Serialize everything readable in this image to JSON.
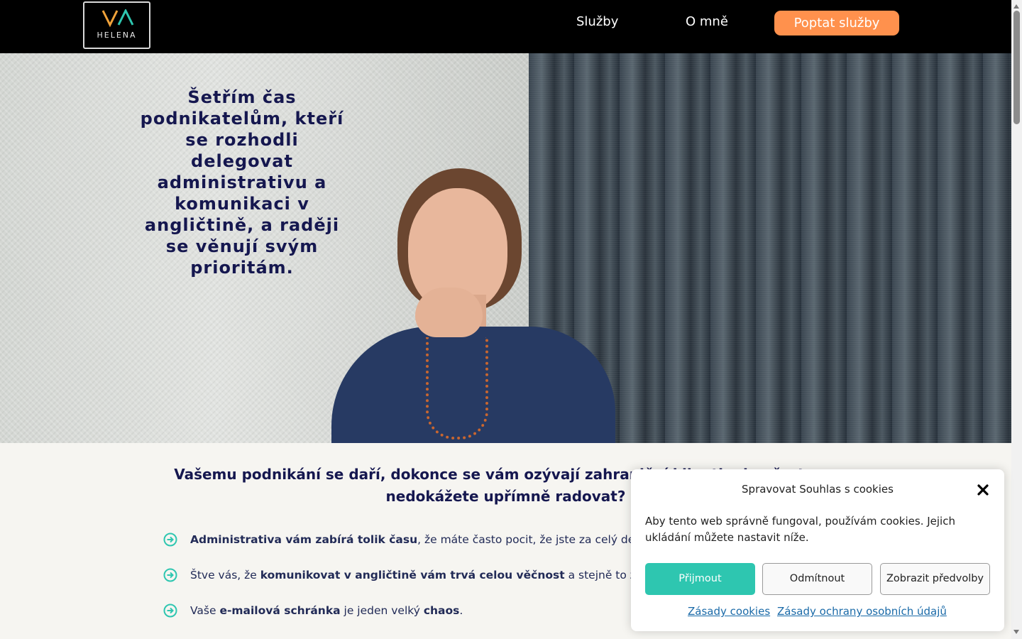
{
  "header": {
    "logo_text": "HELENA",
    "nav": [
      {
        "label": "Služby"
      },
      {
        "label": "O mně"
      }
    ],
    "cta_label": "Poptat služby"
  },
  "hero": {
    "title": "Šetřím čas podnikatelům, kteří se rozhodli delegovat administrativu a komunikaci v angličtině, a raději se věnují svým prioritám."
  },
  "content": {
    "intro": "Vašemu podnikání se daří, dokonce se vám ozývají zahraniční klienti, ale přesto se nedokážete upřímně radovat?",
    "bullets": [
      {
        "pre": "",
        "bold": "Administrativa vám zabírá tolik času",
        "post": ", že máte často pocit, že jste za celý den nic pořádně neudělali."
      },
      {
        "pre": "Štve vás, že ",
        "bold": "komunikovat v angličtině vám trvá celou věčnost",
        "post": " a stejně to zní kostrbatě."
      },
      {
        "pre": "Vaše ",
        "bold": "e-mailová schránka",
        "post": " je jeden velký ",
        "bold2": "chaos",
        "post2": "."
      }
    ]
  },
  "cookie": {
    "title": "Spravovat Souhlas s cookies",
    "text": "Aby tento web správně fungoval, používám cookies. Jejich ukládání můžete nastavit níže.",
    "accept": "Přijmout",
    "deny": "Odmítnout",
    "prefs": "Zobrazit předvolby",
    "link_cookies": "Zásady cookies",
    "link_privacy": "Zásady ochrany osobních údajů"
  },
  "colors": {
    "accent_orange": "#ff914d",
    "accept_teal": "#2ec6b0",
    "heading_navy": "#15174f",
    "bullet_icon": "#2ec6b0"
  }
}
